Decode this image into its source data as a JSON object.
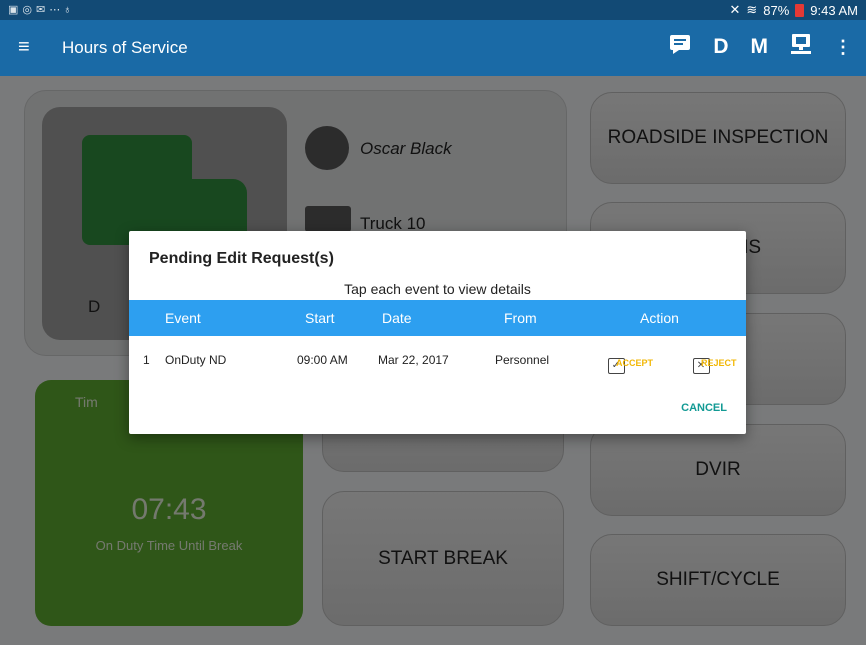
{
  "status_bar": {
    "left_icons": [
      "gallery-icon",
      "tracking-icon",
      "mail-icon",
      "usb-icon"
    ],
    "signal_glyph": "✕",
    "battery_percent": "87%",
    "time": "9:43 AM"
  },
  "app_bar": {
    "title": "Hours of Service",
    "actions": {
      "messages_icon": "messages-icon",
      "d_label": "D",
      "m_label": "M",
      "device_icon": "device-icon",
      "overflow_icon": "more-vert-icon"
    }
  },
  "background": {
    "driver_name": "Oscar Black",
    "vehicle": "Truck 10",
    "status_partial": "D",
    "timer_label_partial": "Tim",
    "timer_value": "07:43",
    "timer_caption": "On Duty Time Until Break",
    "buttons": {
      "roadside": "ROADSIDE INSPECTION",
      "partial_ns": "NS",
      "dvir": "DVIR",
      "start_break": "START BREAK",
      "shift_cycle": "SHIFT/CYCLE"
    }
  },
  "dialog": {
    "title": "Pending Edit Request(s)",
    "subtitle": "Tap each event to view details",
    "columns": [
      "Event",
      "Start",
      "Date",
      "From",
      "Action"
    ],
    "rows": [
      {
        "index": "1",
        "event": "OnDuty ND",
        "start": "09:00 AM",
        "date": "Mar 22, 2017",
        "from": "Personnel",
        "accept": "ACCEPT",
        "reject": "REJECT"
      }
    ],
    "cancel": "CANCEL",
    "colors": {
      "header": "#2d9ff0",
      "action": "#f2b705",
      "cancel": "#129a94"
    }
  }
}
